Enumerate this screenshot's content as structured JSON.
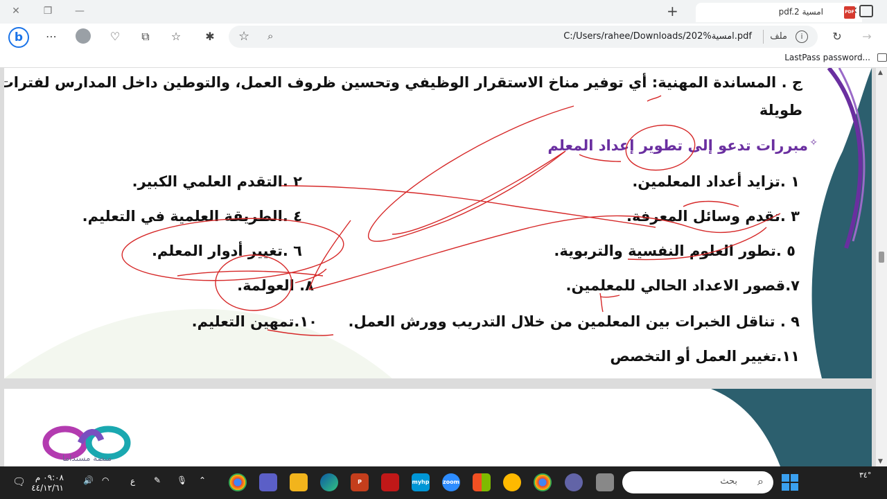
{
  "browser": {
    "tab_title": "امسية pdf.2",
    "tab_icon_label": "PDF",
    "url": "C:/Users/rahee/Downloads/202%امسية.pdf",
    "address_label": "ملف",
    "favorites_item": "LastPass password..."
  },
  "pdf": {
    "line1": "ج . المساندة المهنية: أي توفير مناخ الاستقرار الوظيفي وتحسين ظروف العمل، والتوطين داخل المدارس لفترات",
    "line2": "طويلة",
    "heading": "مبررات تدعو إلى تطوير إعداد المعلم",
    "items_right": [
      "١ .تزايد أعداد المعلمين.",
      "٣ .تقدم وسائل المعرفة.",
      "٥ .تطور العلوم النفسية والتربوية.",
      "٧.قصور الاعداد الحالي للمعلمين.",
      "٩ . تناقل الخبرات بين المعلمين من خلال التدريب وورش العمل.",
      "١١.تغيير العمل أو التخصص"
    ],
    "items_left": [
      "٢ .التقدم العلمي الكبير.",
      "٤ .الطريقة العلمية في التعليم.",
      "٦ .تغيير أدوار المعلم.",
      "٨. العولمة.",
      "١٠.تمهين التعليم."
    ]
  },
  "page2": {
    "logo_text": "منصة مستداما"
  },
  "taskbar": {
    "search_placeholder": "بحث",
    "time": "٠٩:٠٨ م",
    "date": "٤٤/١٢/٦١",
    "lang": "ع",
    "temperature": "٣٤°",
    "powerpoint_label": "P",
    "myhp_label": "myhp",
    "zoom_label": "zoom"
  },
  "colors": {
    "annotation_red": "#d62828",
    "heading_purple": "#6a2fa0",
    "teal_decor": "#2c5f6e"
  }
}
